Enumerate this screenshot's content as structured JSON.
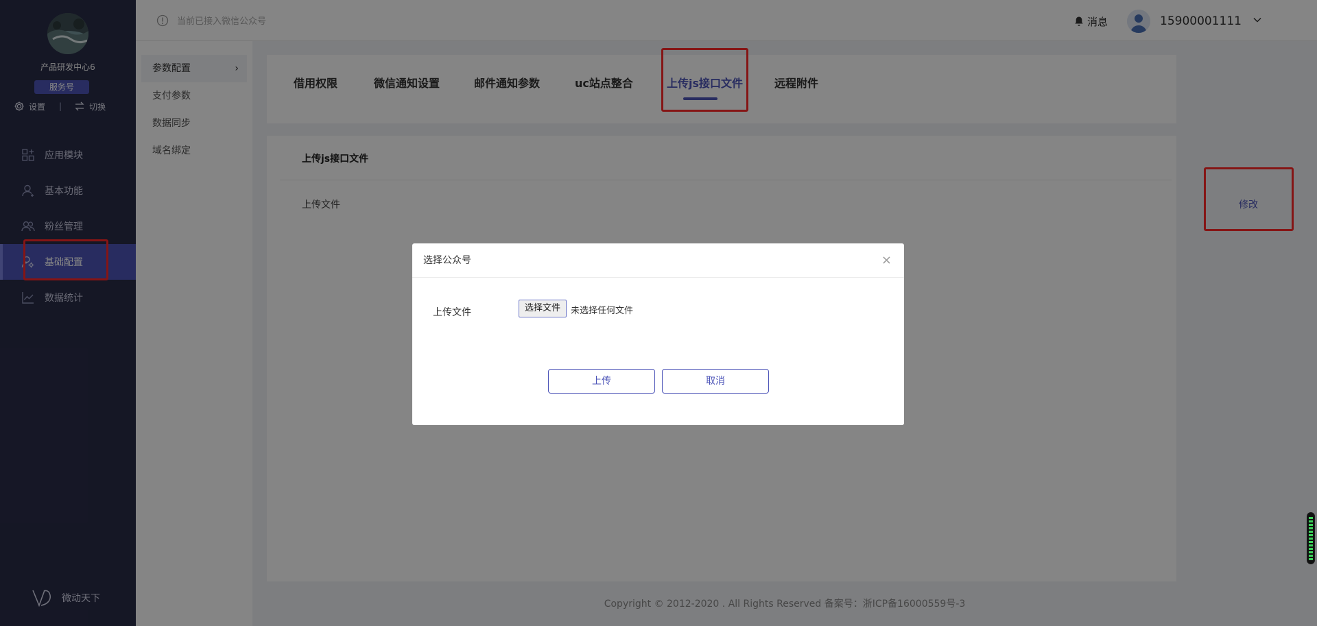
{
  "account": {
    "name": "产品研发中心6",
    "badge": "服务号",
    "settings_label": "设置",
    "separator": "|",
    "switch_label": "切换"
  },
  "nav": {
    "items": [
      {
        "label": "应用模块",
        "icon": "grid-add-icon"
      },
      {
        "label": "基本功能",
        "icon": "user-icon"
      },
      {
        "label": "粉丝管理",
        "icon": "users-icon"
      },
      {
        "label": "基础配置",
        "icon": "config-user-icon"
      },
      {
        "label": "数据统计",
        "icon": "line-chart-icon"
      }
    ],
    "active_index": 3
  },
  "brand": {
    "name": "微动天下",
    "icon": "brand-logo-icon"
  },
  "subnav": {
    "items": [
      "参数配置",
      "支付参数",
      "数据同步",
      "域名绑定"
    ],
    "active_index": 0
  },
  "topbar": {
    "notice": "当前已接入微信公众号",
    "messages_label": "消息",
    "username": "15900001111"
  },
  "tabs": {
    "items": [
      "借用权限",
      "微信通知设置",
      "邮件通知参数",
      "uc站点整合",
      "上传js接口文件",
      "远程附件"
    ],
    "active_index": 4
  },
  "section": {
    "title": "上传js接口文件",
    "row_label": "上传文件",
    "edit_label": "修改"
  },
  "footer": {
    "text": "Copyright © 2012-2020 . All Rights Reserved 备案号：浙ICP备16000559号-3"
  },
  "modal": {
    "title": "选择公众号",
    "close": "×",
    "field_label": "上传文件",
    "file_button": "选择文件",
    "file_status": "未选择任何文件",
    "upload_label": "上传",
    "cancel_label": "取消"
  },
  "colors": {
    "sidebar_bg": "#2a2c48",
    "accent": "#4d55b8",
    "highlight": "#ff2a2a"
  }
}
